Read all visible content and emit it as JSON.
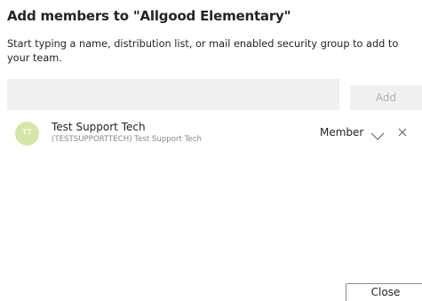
{
  "dialog": {
    "title": "Add members to \"Allgood Elementary\"",
    "subtitle": "Start typing a name, distribution list, or mail enabled security group to add to your team."
  },
  "search": {
    "value": "",
    "placeholder": ""
  },
  "add_button": {
    "label": "Add"
  },
  "members": [
    {
      "initials": "TT",
      "name": "Test Support Tech",
      "detail": "(TESTSUPPORTTECH) Test Support Tech",
      "role": "Member"
    }
  ],
  "icons": {
    "role_dropdown": "chevron-down-icon",
    "remove_member": "close-icon"
  },
  "colors": {
    "avatar_bg": "#d6e6a8",
    "input_bg": "#f0f0f0",
    "disabled_text": "#b3b0ad"
  },
  "footer": {
    "close_label": "Close"
  }
}
